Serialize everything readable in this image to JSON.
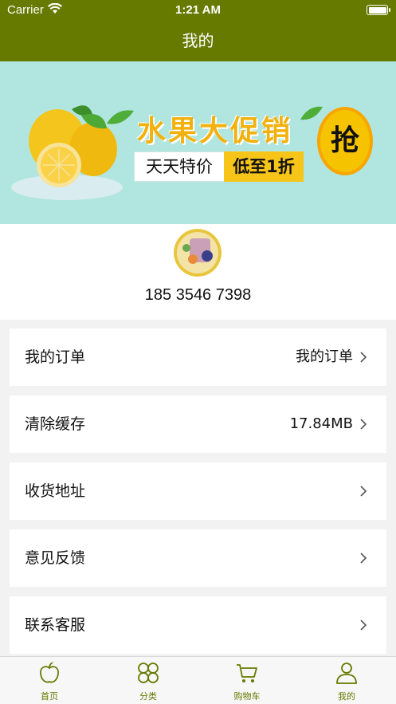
{
  "status_bar": {
    "carrier": "Carrier",
    "time": "1:21 AM"
  },
  "nav": {
    "title": "我的"
  },
  "banner": {
    "headline": "水果大促销",
    "sub_left": "天天特价",
    "sub_right": "低至1折",
    "badge": "抢"
  },
  "profile": {
    "phone": "185 3546 7398"
  },
  "menu": [
    {
      "label": "我的订单",
      "value": "我的订单"
    },
    {
      "label": "清除缓存",
      "value": "17.84MB"
    },
    {
      "label": "收货地址",
      "value": ""
    },
    {
      "label": "意见反馈",
      "value": ""
    },
    {
      "label": "联系客服",
      "value": ""
    }
  ],
  "tabs": [
    {
      "label": "首页",
      "icon": "apple-icon"
    },
    {
      "label": "分类",
      "icon": "category-icon"
    },
    {
      "label": "购物车",
      "icon": "cart-icon"
    },
    {
      "label": "我的",
      "icon": "user-icon"
    }
  ],
  "colors": {
    "primary": "#667a00",
    "banner_bg": "#b1e6e0",
    "background": "#f2f2f2"
  }
}
